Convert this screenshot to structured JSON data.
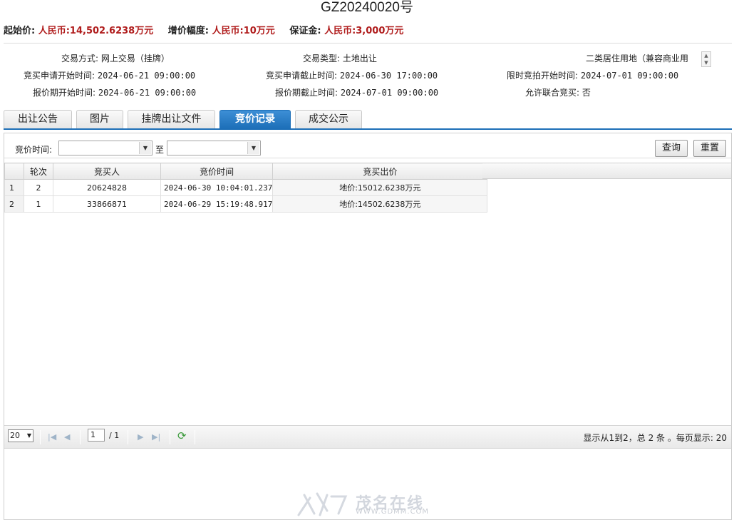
{
  "header": {
    "title": "GZ20240020号"
  },
  "prices": {
    "start_label": "起始价:",
    "start_value": "人民币:14,502.6238万元",
    "increment_label": "增价幅度:",
    "increment_value": "人民币:10万元",
    "deposit_label": "保证金:",
    "deposit_value": "人民币:3,000万元"
  },
  "info": {
    "trade_method_label": "交易方式:",
    "trade_method_value": "网上交易（挂牌）",
    "trade_type_label": "交易类型:",
    "trade_type_value": "土地出让",
    "land_use_value": "二类居住用地（兼容商业用",
    "apply_start_label": "竞买申请开始时间:",
    "apply_start_value": "2024-06-21 09:00:00",
    "apply_end_label": "竞买申请截止时间:",
    "apply_end_value": "2024-06-30 17:00:00",
    "auction_start_label": "限时竞拍开始时间:",
    "auction_start_value": "2024-07-01 09:00:00",
    "quote_start_label": "报价期开始时间:",
    "quote_start_value": "2024-06-21 09:00:00",
    "quote_end_label": "报价期截止时间:",
    "quote_end_value": "2024-07-01 09:00:00",
    "joint_label": "允许联合竞买:",
    "joint_value": "否"
  },
  "tabs": [
    "出让公告",
    "图片",
    "挂牌出让文件",
    "竞价记录",
    "成交公示"
  ],
  "filter": {
    "label": "竞价时间:",
    "to": "至",
    "query_button": "查询",
    "reset_button": "重置"
  },
  "table": {
    "columns": [
      "轮次",
      "竞买人",
      "竞价时间",
      "竞买出价"
    ],
    "rows": [
      {
        "rn": "1",
        "round": "2",
        "bidder": "20624828",
        "time": "2024-06-30 10:04:01.237",
        "price": "地价:15012.6238万元"
      },
      {
        "rn": "2",
        "round": "1",
        "bidder": "33866871",
        "time": "2024-06-29 15:19:48.917",
        "price": "地价:14502.6238万元"
      }
    ]
  },
  "pager": {
    "page_size": "20",
    "page": "1",
    "total_pages": "/ 1",
    "summary": "显示从1到2，总 2 条 。每页显示: 20"
  },
  "watermark": {
    "text": "茂名在线",
    "url": "WWW.GDMM.COM"
  },
  "colors": {
    "accent": "#1d6fb8",
    "price_red": "#b01c1c"
  }
}
